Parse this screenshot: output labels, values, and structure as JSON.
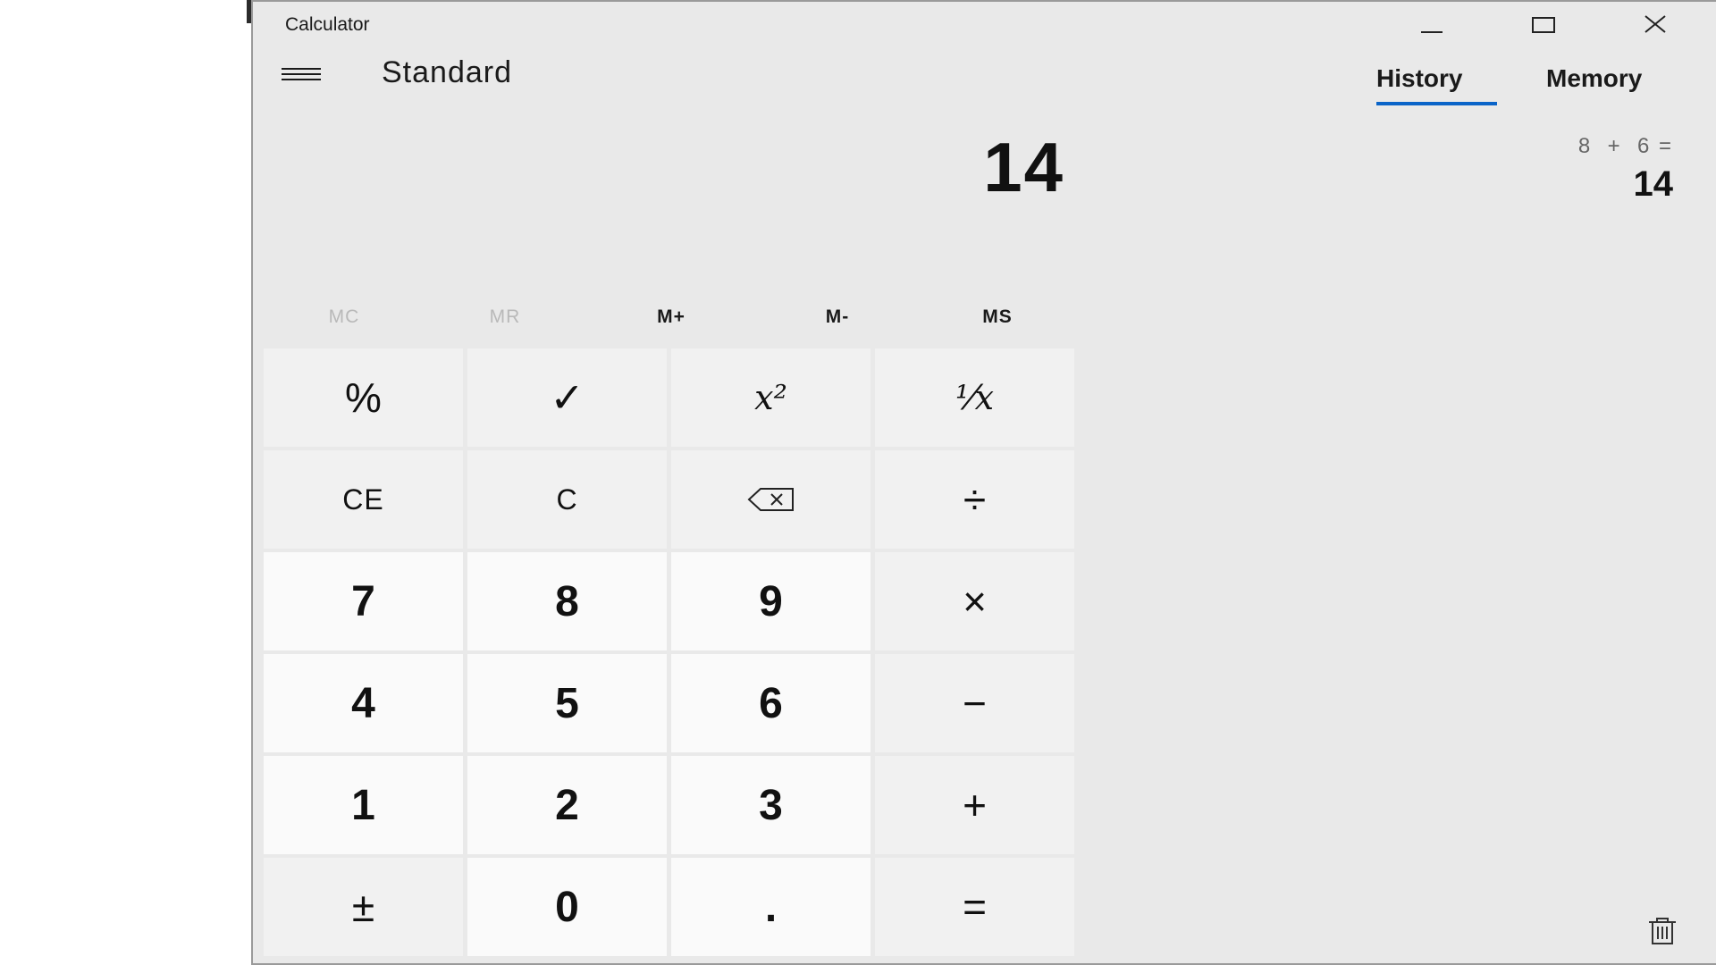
{
  "window": {
    "title": "Calculator"
  },
  "header": {
    "mode": "Standard"
  },
  "display": {
    "value": "14"
  },
  "memory": {
    "buttons": [
      "MC",
      "MR",
      "M+",
      "M-",
      "MS"
    ],
    "disabled": [
      "MC",
      "MR"
    ]
  },
  "keypad": {
    "keys": [
      [
        "%",
        "✓",
        "x²",
        "¹⁄x"
      ],
      [
        "CE",
        "C",
        "⌫",
        "÷"
      ],
      [
        "7",
        "8",
        "9",
        "×"
      ],
      [
        "4",
        "5",
        "6",
        "−"
      ],
      [
        "1",
        "2",
        "3",
        "+"
      ],
      [
        "±",
        "0",
        ".",
        "="
      ]
    ]
  },
  "tabs": {
    "history": "History",
    "memory": "Memory",
    "active": "History"
  },
  "history": {
    "expression": "8  +  6 =",
    "result": "14"
  },
  "icons": {
    "menu": "hamburger-icon",
    "minimize": "minimize-icon",
    "maximize": "maximize-icon",
    "close": "close-icon",
    "delete_history": "trash-icon",
    "backspace": "backspace-icon"
  },
  "colors": {
    "accent": "#0a64c8",
    "background": "#e9e9e9",
    "key_function": "#f1f1f1",
    "key_number": "#fafafa"
  }
}
